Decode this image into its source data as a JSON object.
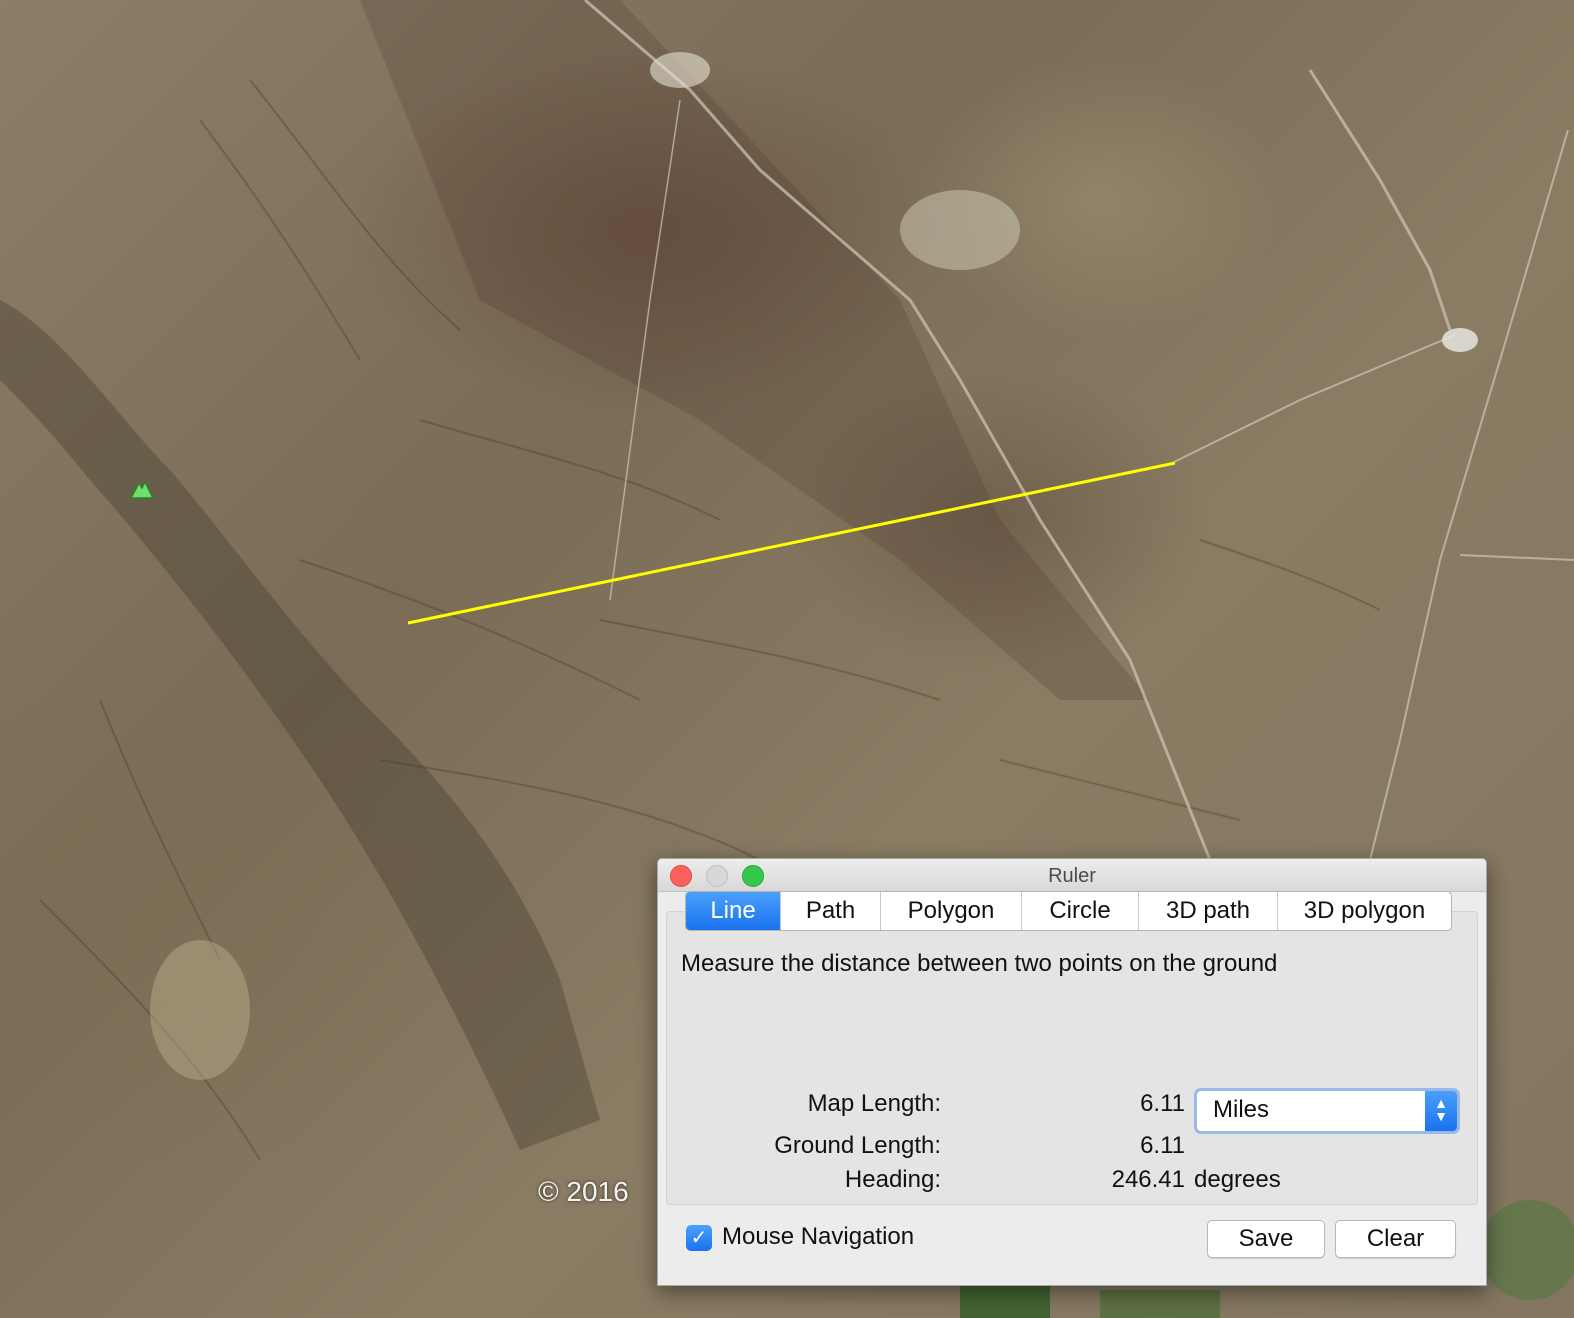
{
  "map": {
    "copyright": "© 2016",
    "measure_line_color": "#ffff00",
    "marker_icon": "mountain-peak-icon",
    "marker_color": "#6ee06b"
  },
  "ruler": {
    "title": "Ruler",
    "window_controls": [
      "close-icon",
      "minimize-icon",
      "zoom-icon"
    ],
    "tabs": [
      {
        "label": "Line",
        "active": true
      },
      {
        "label": "Path",
        "active": false
      },
      {
        "label": "Polygon",
        "active": false
      },
      {
        "label": "Circle",
        "active": false
      },
      {
        "label": "3D path",
        "active": false
      },
      {
        "label": "3D polygon",
        "active": false
      }
    ],
    "description": "Measure the distance between two points on the ground",
    "map_length_label": "Map Length:",
    "map_length_value": "6.11",
    "unit_selected": "Miles",
    "ground_length_label": "Ground Length:",
    "ground_length_value": "6.11",
    "heading_label": "Heading:",
    "heading_value": "246.41",
    "heading_unit": "degrees",
    "mouse_navigation_label": "Mouse Navigation",
    "mouse_navigation_checked": true,
    "save_label": "Save",
    "clear_label": "Clear",
    "accent_color": "#1a72ee"
  }
}
